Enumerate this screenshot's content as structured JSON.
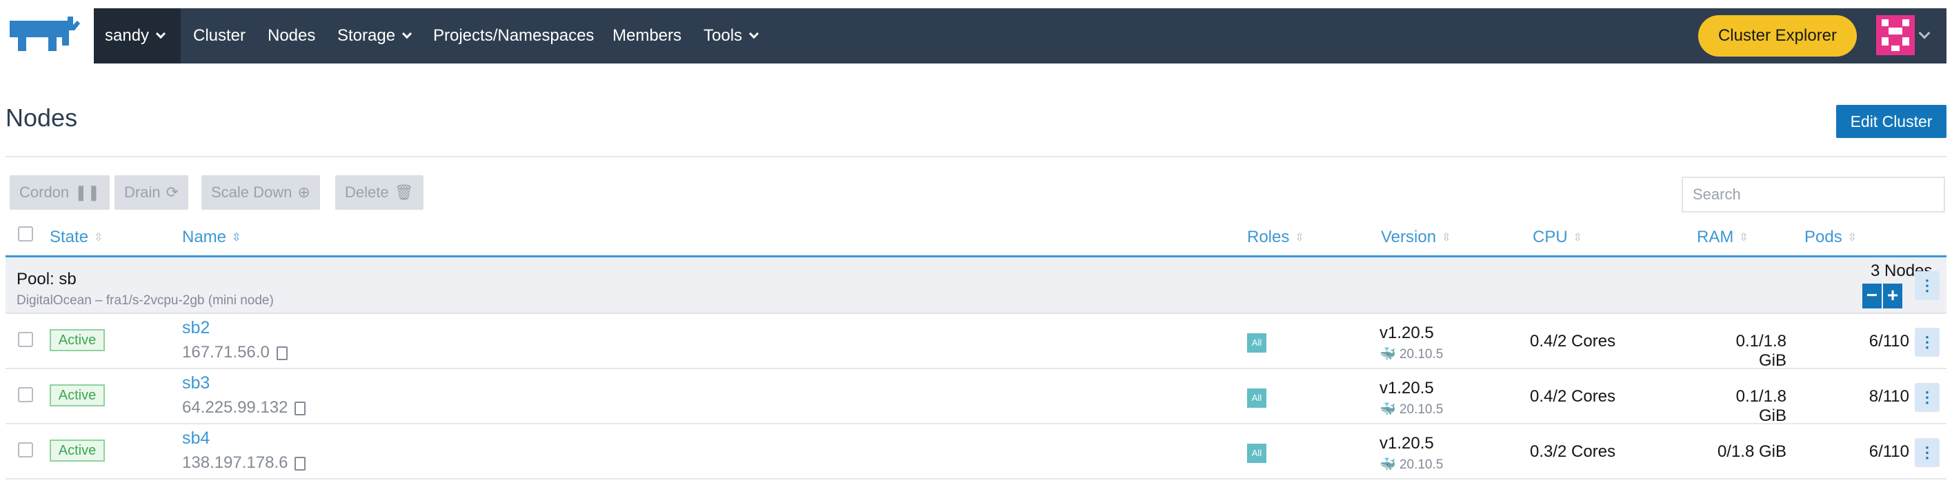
{
  "nav": {
    "cluster": "sandy",
    "items": [
      {
        "label": "Cluster",
        "dropdown": false
      },
      {
        "label": "Nodes",
        "dropdown": false
      },
      {
        "label": "Storage",
        "dropdown": true
      },
      {
        "label": "Projects/Namespaces",
        "dropdown": false
      },
      {
        "label": "Members",
        "dropdown": false
      },
      {
        "label": "Tools",
        "dropdown": true
      }
    ],
    "explorer_button": "Cluster Explorer"
  },
  "page": {
    "title": "Nodes",
    "edit_button": "Edit Cluster"
  },
  "actions": [
    {
      "label": "Cordon",
      "icon": "pause-icon"
    },
    {
      "label": "Drain",
      "icon": "drain-icon"
    },
    {
      "label": "Scale Down",
      "icon": "arrow-down-circle-icon"
    },
    {
      "label": "Delete",
      "icon": "trash-icon"
    }
  ],
  "search": {
    "placeholder": "Search"
  },
  "columns": {
    "state": "State",
    "name": "Name",
    "roles": "Roles",
    "version": "Version",
    "cpu": "CPU",
    "ram": "RAM",
    "pods": "Pods"
  },
  "pool": {
    "name": "Pool: sb",
    "subtitle": "DigitalOcean – fra1/s-2vcpu-2gb (mini node)",
    "count": "3 Nodes",
    "minus": "−",
    "plus": "+"
  },
  "rows": [
    {
      "state": "Active",
      "name": "sb2",
      "ip": "167.71.56.0",
      "role": "All",
      "version": "v1.20.5",
      "docker": "20.10.5",
      "cpu": "0.4/2 Cores",
      "ram": "0.1/1.8 GiB",
      "pods": "6/110"
    },
    {
      "state": "Active",
      "name": "sb3",
      "ip": "64.225.99.132",
      "role": "All",
      "version": "v1.20.5",
      "docker": "20.10.5",
      "cpu": "0.4/2 Cores",
      "ram": "0.1/1.8 GiB",
      "pods": "8/110"
    },
    {
      "state": "Active",
      "name": "sb4",
      "ip": "138.197.178.6",
      "role": "All",
      "version": "v1.20.5",
      "docker": "20.10.5",
      "cpu": "0.3/2 Cores",
      "ram": "0/1.8 GiB",
      "pods": "6/110"
    }
  ],
  "colors": {
    "nav": "#2e3e50",
    "accent": "#1275b9",
    "explorer": "#f4c224",
    "link": "#3d98d3"
  }
}
